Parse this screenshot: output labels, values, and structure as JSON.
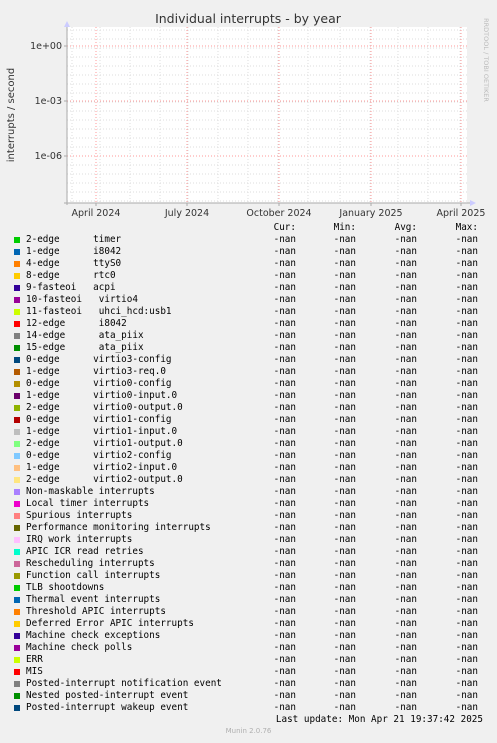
{
  "chart_data": {
    "type": "line",
    "title": "Individual interrupts - by year",
    "ylabel": "interrupts / second",
    "side_label": "RRDTOOL / TOBI OETIKER",
    "y_scale": "log",
    "y_ticks": [
      "1e+00",
      "1e-03",
      "1e-06"
    ],
    "x_ticks": [
      "April 2024",
      "July 2024",
      "October 2024",
      "January 2025",
      "April 2025"
    ],
    "grid": true,
    "legend_columns": [
      "Cur:",
      "Min:",
      "Avg:",
      "Max:"
    ],
    "series": [
      {
        "name": "2-edge      timer",
        "color": "#00cc00",
        "cur": "-nan",
        "min": "-nan",
        "avg": "-nan",
        "max": "-nan"
      },
      {
        "name": "1-edge      i8042",
        "color": "#0066b3",
        "cur": "-nan",
        "min": "-nan",
        "avg": "-nan",
        "max": "-nan"
      },
      {
        "name": "4-edge      ttyS0",
        "color": "#ff8000",
        "cur": "-nan",
        "min": "-nan",
        "avg": "-nan",
        "max": "-nan"
      },
      {
        "name": "8-edge      rtc0",
        "color": "#ffcc00",
        "cur": "-nan",
        "min": "-nan",
        "avg": "-nan",
        "max": "-nan"
      },
      {
        "name": "9-fasteoi   acpi",
        "color": "#330099",
        "cur": "-nan",
        "min": "-nan",
        "avg": "-nan",
        "max": "-nan"
      },
      {
        "name": "10-fasteoi   virtio4",
        "color": "#990099",
        "cur": "-nan",
        "min": "-nan",
        "avg": "-nan",
        "max": "-nan"
      },
      {
        "name": "11-fasteoi   uhci_hcd:usb1",
        "color": "#ccff00",
        "cur": "-nan",
        "min": "-nan",
        "avg": "-nan",
        "max": "-nan"
      },
      {
        "name": "12-edge      i8042",
        "color": "#ff0000",
        "cur": "-nan",
        "min": "-nan",
        "avg": "-nan",
        "max": "-nan"
      },
      {
        "name": "14-edge      ata_piix",
        "color": "#808080",
        "cur": "-nan",
        "min": "-nan",
        "avg": "-nan",
        "max": "-nan"
      },
      {
        "name": "15-edge      ata_piix",
        "color": "#008f00",
        "cur": "-nan",
        "min": "-nan",
        "avg": "-nan",
        "max": "-nan"
      },
      {
        "name": "0-edge      virtio3-config",
        "color": "#00487d",
        "cur": "-nan",
        "min": "-nan",
        "avg": "-nan",
        "max": "-nan"
      },
      {
        "name": "1-edge      virtio3-req.0",
        "color": "#b35a00",
        "cur": "-nan",
        "min": "-nan",
        "avg": "-nan",
        "max": "-nan"
      },
      {
        "name": "0-edge      virtio0-config",
        "color": "#b38f00",
        "cur": "-nan",
        "min": "-nan",
        "avg": "-nan",
        "max": "-nan"
      },
      {
        "name": "1-edge      virtio0-input.0",
        "color": "#6b006b",
        "cur": "-nan",
        "min": "-nan",
        "avg": "-nan",
        "max": "-nan"
      },
      {
        "name": "2-edge      virtio0-output.0",
        "color": "#8fb300",
        "cur": "-nan",
        "min": "-nan",
        "avg": "-nan",
        "max": "-nan"
      },
      {
        "name": "0-edge      virtio1-config",
        "color": "#b30000",
        "cur": "-nan",
        "min": "-nan",
        "avg": "-nan",
        "max": "-nan"
      },
      {
        "name": "1-edge      virtio1-input.0",
        "color": "#bebebe",
        "cur": "-nan",
        "min": "-nan",
        "avg": "-nan",
        "max": "-nan"
      },
      {
        "name": "2-edge      virtio1-output.0",
        "color": "#80ff80",
        "cur": "-nan",
        "min": "-nan",
        "avg": "-nan",
        "max": "-nan"
      },
      {
        "name": "0-edge      virtio2-config",
        "color": "#80c9ff",
        "cur": "-nan",
        "min": "-nan",
        "avg": "-nan",
        "max": "-nan"
      },
      {
        "name": "1-edge      virtio2-input.0",
        "color": "#ffc080",
        "cur": "-nan",
        "min": "-nan",
        "avg": "-nan",
        "max": "-nan"
      },
      {
        "name": "2-edge      virtio2-output.0",
        "color": "#ffe680",
        "cur": "-nan",
        "min": "-nan",
        "avg": "-nan",
        "max": "-nan"
      },
      {
        "name": "Non-maskable interrupts",
        "color": "#aa80ff",
        "cur": "-nan",
        "min": "-nan",
        "avg": "-nan",
        "max": "-nan"
      },
      {
        "name": "Local timer interrupts",
        "color": "#ee00cc",
        "cur": "-nan",
        "min": "-nan",
        "avg": "-nan",
        "max": "-nan"
      },
      {
        "name": "Spurious interrupts",
        "color": "#ff8080",
        "cur": "-nan",
        "min": "-nan",
        "avg": "-nan",
        "max": "-nan"
      },
      {
        "name": "Performance monitoring interrupts",
        "color": "#666600",
        "cur": "-nan",
        "min": "-nan",
        "avg": "-nan",
        "max": "-nan"
      },
      {
        "name": "IRQ work interrupts",
        "color": "#ffbfff",
        "cur": "-nan",
        "min": "-nan",
        "avg": "-nan",
        "max": "-nan"
      },
      {
        "name": "APIC ICR read retries",
        "color": "#00ffcc",
        "cur": "-nan",
        "min": "-nan",
        "avg": "-nan",
        "max": "-nan"
      },
      {
        "name": "Rescheduling interrupts",
        "color": "#cc6699",
        "cur": "-nan",
        "min": "-nan",
        "avg": "-nan",
        "max": "-nan"
      },
      {
        "name": "Function call interrupts",
        "color": "#999900",
        "cur": "-nan",
        "min": "-nan",
        "avg": "-nan",
        "max": "-nan"
      },
      {
        "name": "TLB shootdowns",
        "color": "#00cc00",
        "cur": "-nan",
        "min": "-nan",
        "avg": "-nan",
        "max": "-nan"
      },
      {
        "name": "Thermal event interrupts",
        "color": "#0066b3",
        "cur": "-nan",
        "min": "-nan",
        "avg": "-nan",
        "max": "-nan"
      },
      {
        "name": "Threshold APIC interrupts",
        "color": "#ff8000",
        "cur": "-nan",
        "min": "-nan",
        "avg": "-nan",
        "max": "-nan"
      },
      {
        "name": "Deferred Error APIC interrupts",
        "color": "#ffcc00",
        "cur": "-nan",
        "min": "-nan",
        "avg": "-nan",
        "max": "-nan"
      },
      {
        "name": "Machine check exceptions",
        "color": "#330099",
        "cur": "-nan",
        "min": "-nan",
        "avg": "-nan",
        "max": "-nan"
      },
      {
        "name": "Machine check polls",
        "color": "#990099",
        "cur": "-nan",
        "min": "-nan",
        "avg": "-nan",
        "max": "-nan"
      },
      {
        "name": "ERR",
        "color": "#ccff00",
        "cur": "-nan",
        "min": "-nan",
        "avg": "-nan",
        "max": "-nan"
      },
      {
        "name": "MIS",
        "color": "#ff0000",
        "cur": "-nan",
        "min": "-nan",
        "avg": "-nan",
        "max": "-nan"
      },
      {
        "name": "Posted-interrupt notification event",
        "color": "#808080",
        "cur": "-nan",
        "min": "-nan",
        "avg": "-nan",
        "max": "-nan"
      },
      {
        "name": "Nested posted-interrupt event",
        "color": "#008f00",
        "cur": "-nan",
        "min": "-nan",
        "avg": "-nan",
        "max": "-nan"
      },
      {
        "name": "Posted-interrupt wakeup event",
        "color": "#00487d",
        "cur": "-nan",
        "min": "-nan",
        "avg": "-nan",
        "max": "-nan"
      }
    ]
  },
  "last_update": "Last update: Mon Apr 21 19:37:42 2025",
  "footer": "Munin 2.0.76",
  "colors": {
    "background": "#f0f0f0",
    "plot": "#ffffff",
    "major_grid": "#ff9999",
    "minor_grid": "#dddddd"
  }
}
